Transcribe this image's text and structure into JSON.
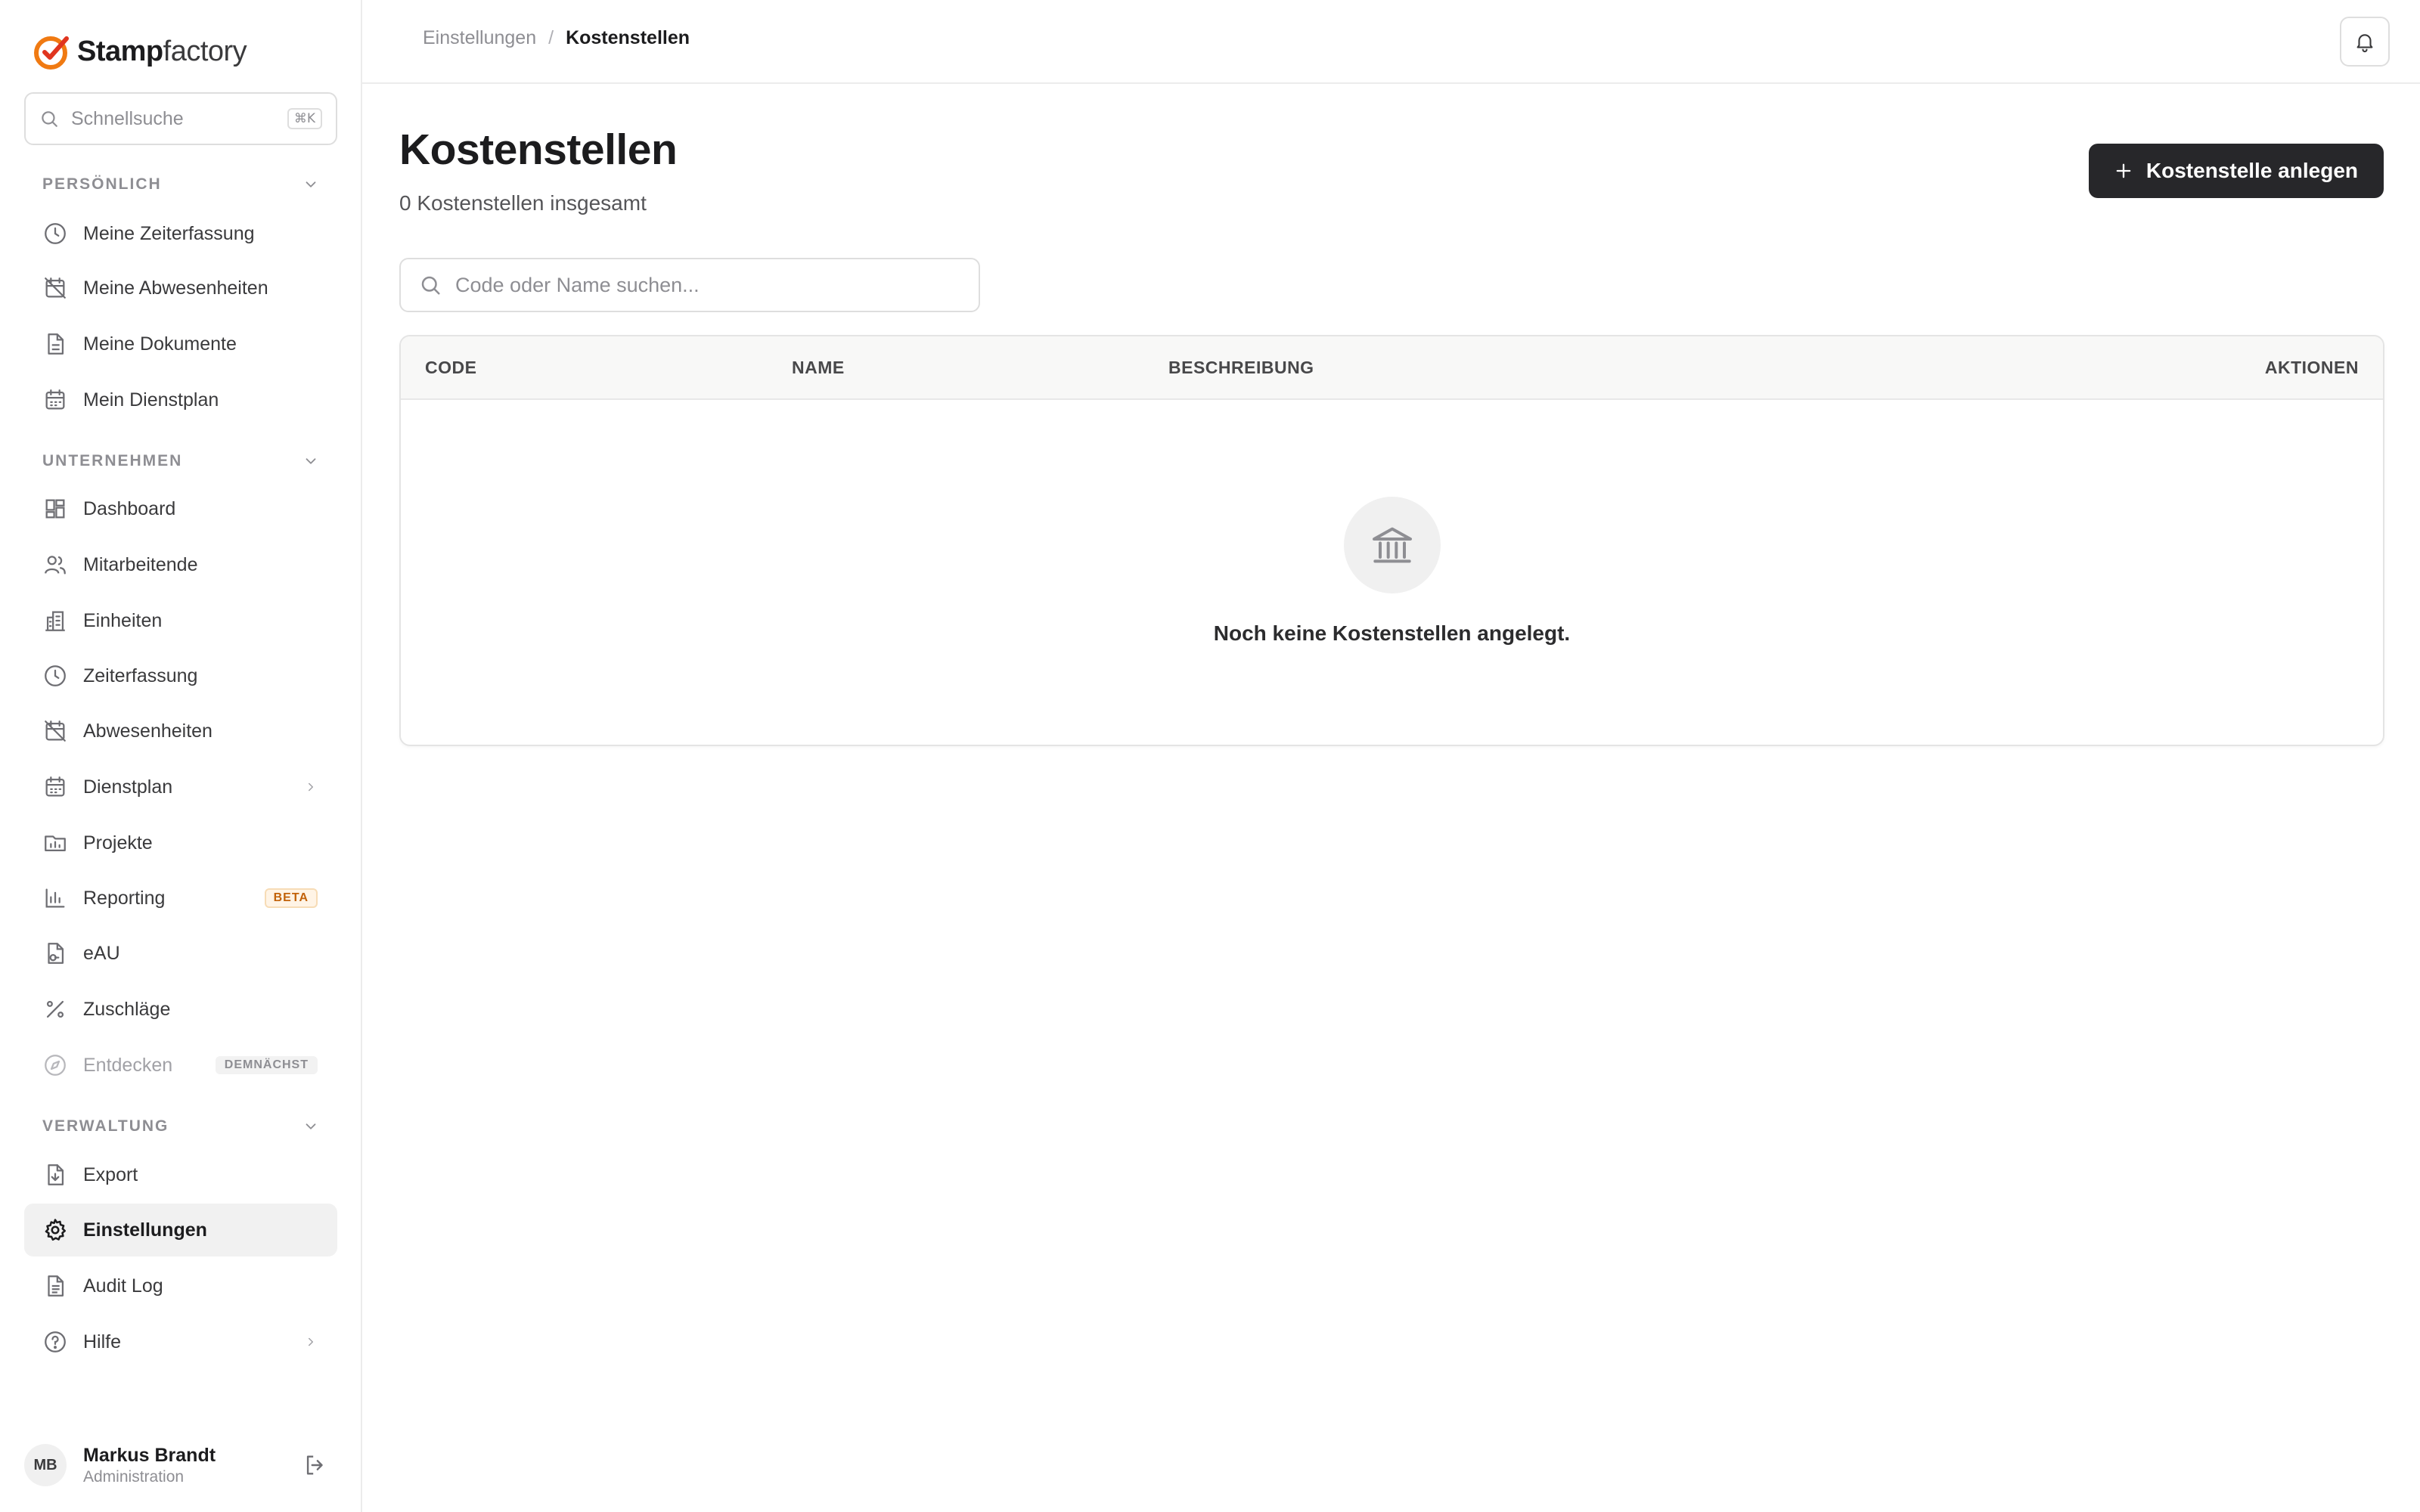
{
  "brand": {
    "name_bold": "Stamp",
    "name_light": "factory",
    "accent": "#f07a12"
  },
  "quick_search": {
    "placeholder": "Schnellsuche",
    "shortcut": "⌘K"
  },
  "sidebar": {
    "personal": {
      "title": "PERSÖNLICH",
      "items": [
        {
          "label": "Meine Zeiterfassung",
          "icon": "clock-icon"
        },
        {
          "label": "Meine Abwesenheiten",
          "icon": "calendar-off-icon"
        },
        {
          "label": "Meine Dokumente",
          "icon": "document-icon"
        },
        {
          "label": "Mein Dienstplan",
          "icon": "calendar-icon"
        }
      ]
    },
    "company": {
      "title": "UNTERNEHMEN",
      "items": [
        {
          "label": "Dashboard",
          "icon": "dashboard-icon"
        },
        {
          "label": "Mitarbeitende",
          "icon": "users-icon"
        },
        {
          "label": "Einheiten",
          "icon": "building-icon"
        },
        {
          "label": "Zeiterfassung",
          "icon": "clock-icon"
        },
        {
          "label": "Abwesenheiten",
          "icon": "calendar-off-icon"
        },
        {
          "label": "Dienstplan",
          "icon": "calendar-icon"
        },
        {
          "label": "Projekte",
          "icon": "folder-icon"
        },
        {
          "label": "Reporting",
          "icon": "bar-chart-icon",
          "badge": "BETA"
        },
        {
          "label": "eAU",
          "icon": "medical-file-icon"
        },
        {
          "label": "Zuschläge",
          "icon": "percent-icon"
        },
        {
          "label": "Entdecken",
          "icon": "compass-icon",
          "badge": "DEMNÄCHST"
        }
      ]
    },
    "admin": {
      "title": "VERWALTUNG",
      "items": [
        {
          "label": "Export",
          "icon": "file-export-icon"
        },
        {
          "label": "Einstellungen",
          "icon": "gear-icon"
        },
        {
          "label": "Audit Log",
          "icon": "document-list-icon"
        },
        {
          "label": "Hilfe",
          "icon": "help-circle-icon"
        }
      ]
    }
  },
  "user": {
    "initials": "MB",
    "name": "Markus Brandt",
    "role": "Administration"
  },
  "breadcrumb": {
    "parent": "Einstellungen",
    "separator": "/",
    "current": "Kostenstellen"
  },
  "page": {
    "title": "Kostenstellen",
    "subtitle": "0 Kostenstellen insgesamt",
    "add_button": "Kostenstelle anlegen",
    "search_placeholder": "Code oder Name suchen..."
  },
  "table": {
    "columns": [
      "CODE",
      "NAME",
      "BESCHREIBUNG",
      "AKTIONEN"
    ],
    "rows": [],
    "empty_message": "Noch keine Kostenstellen angelegt."
  }
}
